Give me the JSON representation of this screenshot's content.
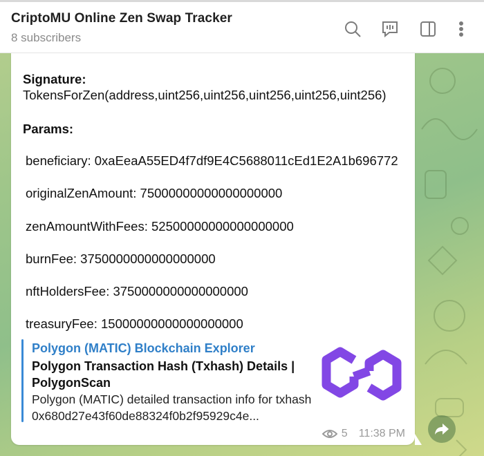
{
  "colors": {
    "accent": "#2f7fc8",
    "preview_bar": "#3a8ad6",
    "polygon_purple": "#8247e5",
    "meta_gray": "#9a9a9a"
  },
  "header": {
    "title": "CriptoMU Online Zen Swap Tracker",
    "subtitle": "8 subscribers",
    "icons": [
      "search-icon",
      "chat-icon",
      "sidebar-toggle-icon",
      "more-icon"
    ]
  },
  "message": {
    "signature_label": "Signature:",
    "signature_value": "TokensForZen(address,uint256,uint256,uint256,uint256,uint256)",
    "params_label": "Params:",
    "params": [
      "beneficiary: 0xaEeaA55ED4f7df9E4C5688011cEd1E2A1b696772",
      "originalZenAmount: 75000000000000000000",
      "zenAmountWithFees: 52500000000000000000",
      "burnFee: 3750000000000000000",
      "nftHoldersFee: 3750000000000000000",
      "treasuryFee: 15000000000000000000"
    ],
    "preview": {
      "site": "Polygon (MATIC) Blockchain Explorer",
      "title": "Polygon Transaction Hash (Txhash) Details | PolygonScan",
      "description": "Polygon (MATIC) detailed transaction info for txhash 0x680d27e43f60de88324f0b2f95929c4e..."
    },
    "views": "5",
    "time": "11:38 PM"
  }
}
